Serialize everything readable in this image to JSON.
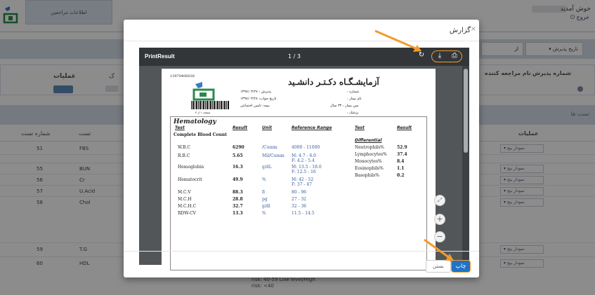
{
  "header": {
    "tab_label": "اطلاعات مراجعین",
    "user_greeting": "خوش آمدید",
    "logout": "خروج"
  },
  "filters": {
    "date_select": "تاریخ پذیرش",
    "from_label": "از"
  },
  "patients_table": {
    "ops_header": "عملیات",
    "second_header": "ک",
    "name_header": "نام مراجعه کننده",
    "num_header": "شماره پذیرش"
  },
  "tests": {
    "section_title": "تست ها",
    "col_num": "شماره تست",
    "col_test": "تست",
    "col_ops": "عملیات",
    "rows": [
      {
        "num": "51",
        "test": "FBS"
      },
      {
        "num": "55",
        "test": "BUN"
      },
      {
        "num": "56",
        "test": "Cr"
      },
      {
        "num": "57",
        "test": "U.Acid"
      },
      {
        "num": "58",
        "test": "Chol"
      },
      {
        "num": "59",
        "test": "T.G"
      },
      {
        "num": "60",
        "test": "HDL"
      }
    ],
    "select_label": "نمودار بیج",
    "reference_text": "risk: 40-59 Low level/High\nrisk: <40"
  },
  "modal": {
    "title": "گزارش",
    "close_label": "بستن",
    "print_label": "چاپ",
    "viewer": {
      "title": "PrintResult",
      "page": "1 / 3",
      "rotate_icon": "refresh-icon",
      "download_icon": "download-icon",
      "print_icon": "print-icon",
      "zoom_in": "+",
      "zoom_out": "−",
      "zoom_fit": "⤢"
    }
  },
  "report": {
    "code": "13970406028",
    "lab_name": "آزمایشـگـاه دکـتـر دانشـید",
    "fields": {
      "number": "شماره :",
      "patient_name": "نام بیمار :",
      "age": "سن بیمار : ۳۴ سال",
      "doctor": "پزشک :",
      "admission": "پذیرش : ۱۳۹۷/۰۳/۲۷",
      "answer_date": "تاریخ جواب: ۱۳۹۷/۰۳/۲۸",
      "insurance": "بیمه: تامین اجتماعی"
    },
    "page_label": "صفحه ۱ از ۳",
    "section": "Hematology",
    "head_test": "Test",
    "head_result": "Result",
    "head_unit": "Unit",
    "head_ref": "Reference Range",
    "head_test2": "Test",
    "head_result2": "Result",
    "subsection": "Complete Blood Count",
    "differential": "Differential",
    "left_rows": [
      {
        "test": "W.B.C",
        "result": "6290",
        "unit": "/Cumm",
        "ref": "4000 - 11000"
      },
      {
        "test": "R.B.C",
        "result": "5.65",
        "unit": "Mil/Cumm",
        "ref": "M: 4.7 - 6.0\nF: 4.2 - 5.4"
      },
      {
        "test": "Hemoglobin",
        "result": "16.3",
        "unit": "g/dL",
        "ref": "M: 13.5 - 18.0\nF: 12.5 - 16"
      },
      {
        "test": "Hematocrit",
        "result": "49.9",
        "unit": "%",
        "ref": "M: 42 - 52\nF: 37 - 47"
      },
      {
        "test": "M.C.V",
        "result": "88.3",
        "unit": "fl",
        "ref": "80 - 96"
      },
      {
        "test": "M.C.H",
        "result": "28.8",
        "unit": "pg",
        "ref": "27 - 32"
      },
      {
        "test": "M.C.H.C",
        "result": "32.7",
        "unit": "g/dl",
        "ref": "32 - 36"
      },
      {
        "test": "RDW-CV",
        "result": "13.3",
        "unit": "%",
        "ref": "11.5 - 14.5"
      }
    ],
    "right_rows": [
      {
        "test": "Neutrophils%",
        "result": "52.9"
      },
      {
        "test": "Lymphocytes%",
        "result": "37.4"
      },
      {
        "test": "Monocytes%",
        "result": "8.4"
      },
      {
        "test": "Eosinophils%",
        "result": "1.1"
      },
      {
        "test": "Basophils%",
        "result": "0.2"
      }
    ]
  },
  "colors": {
    "accent": "#f39a2c",
    "primary": "#1f73c6"
  }
}
